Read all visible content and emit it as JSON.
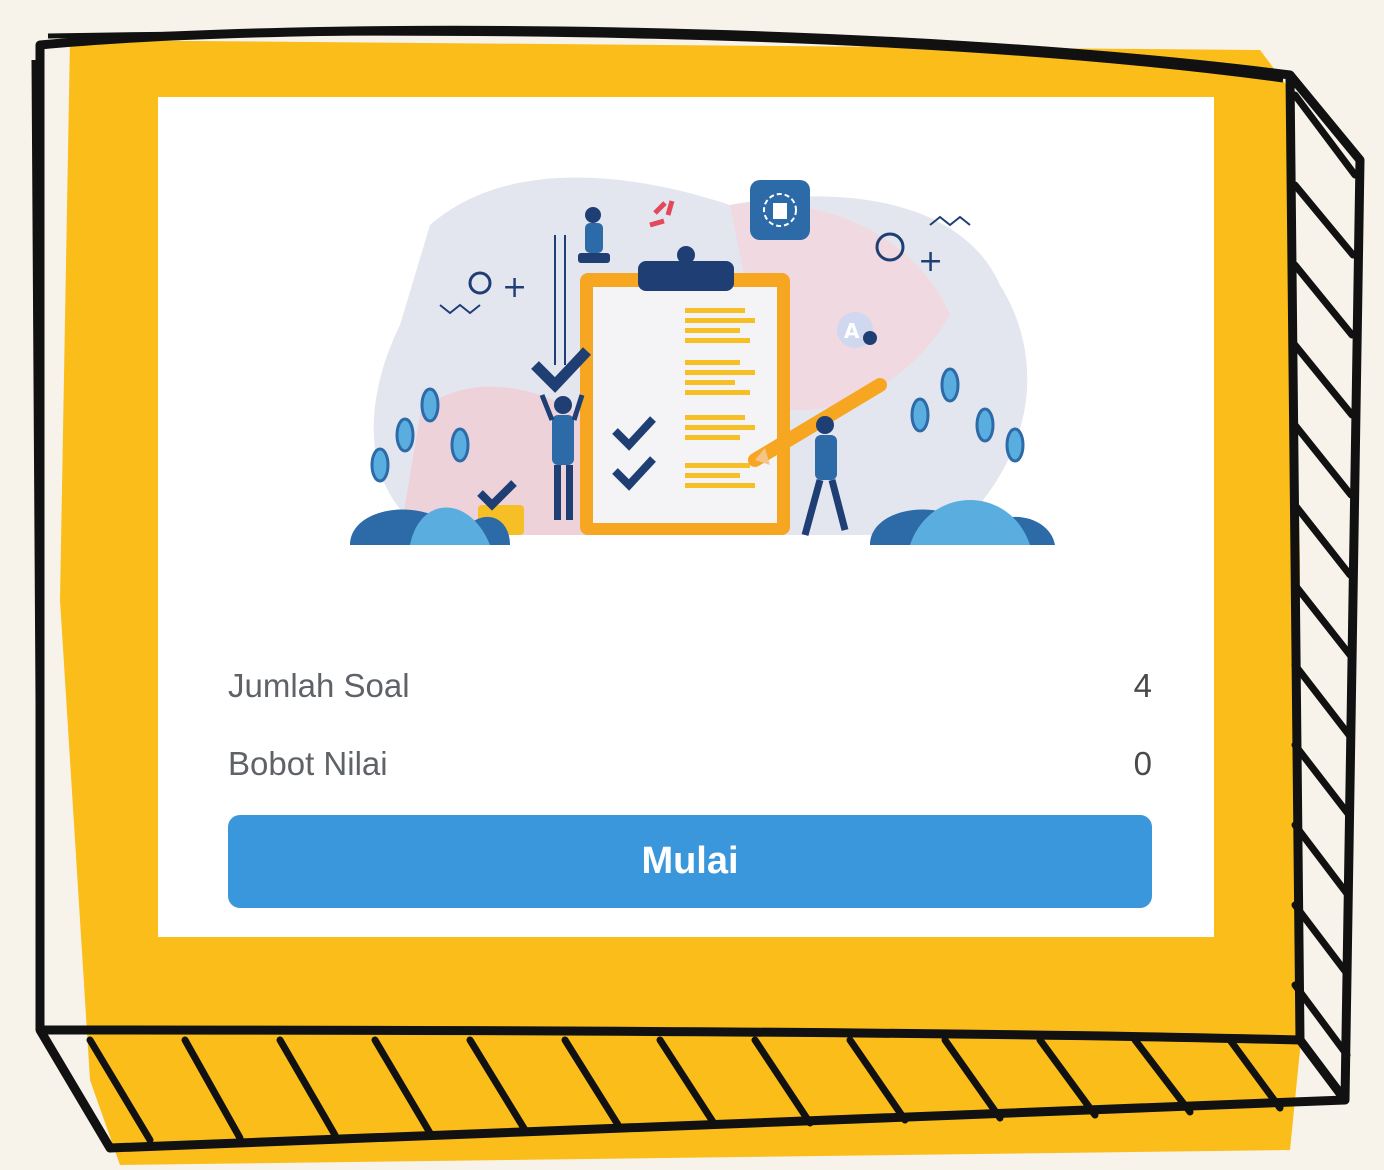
{
  "info": {
    "questions_label": "Jumlah Soal",
    "questions_value": "4",
    "weight_label": "Bobot Nilai",
    "weight_value": "0"
  },
  "actions": {
    "start_label": "Mulai"
  },
  "colors": {
    "frame_yellow": "#fbbd19",
    "background": "#f7f3ea",
    "button_blue": "#3b97db",
    "outline": "#111111"
  },
  "icons": {
    "illustration": "checklist-clipboard-illustration"
  }
}
